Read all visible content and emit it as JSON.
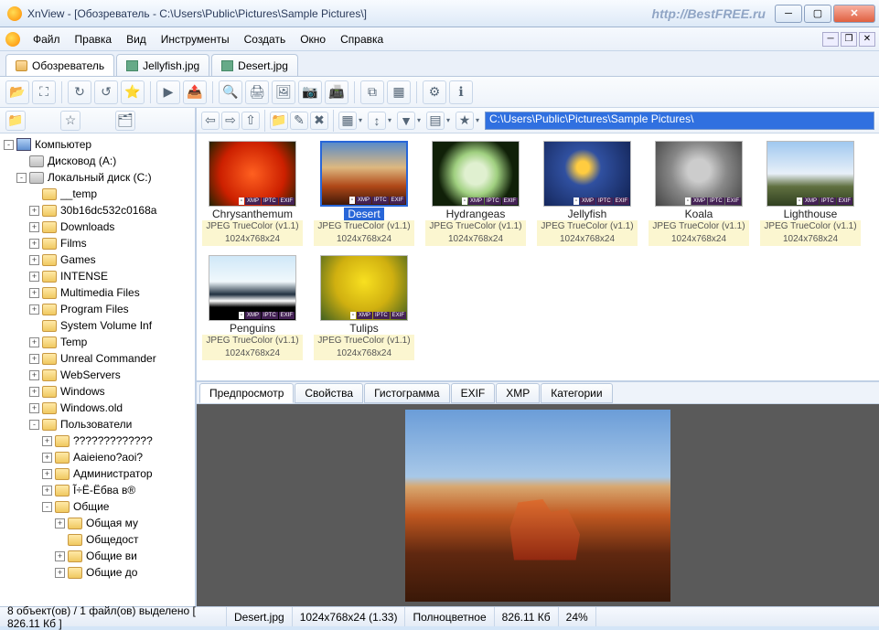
{
  "title": "XnView - [Обозреватель - C:\\Users\\Public\\Pictures\\Sample Pictures\\]",
  "watermark": "http://BestFREE.ru",
  "menu": [
    "Файл",
    "Правка",
    "Вид",
    "Инструменты",
    "Создать",
    "Окно",
    "Справка"
  ],
  "doc_tabs": [
    {
      "label": "Обозреватель",
      "icon": "br",
      "active": true
    },
    {
      "label": "Jellyfish.jpg",
      "icon": "img",
      "active": false
    },
    {
      "label": "Desert.jpg",
      "icon": "img",
      "active": false
    }
  ],
  "address": "C:\\Users\\Public\\Pictures\\Sample Pictures\\",
  "tree": [
    {
      "ind": 0,
      "exp": "-",
      "icon": "pc",
      "label": "Компьютер"
    },
    {
      "ind": 1,
      "exp": "",
      "icon": "drv",
      "label": "Дисковод (A:)"
    },
    {
      "ind": 1,
      "exp": "-",
      "icon": "drv",
      "label": "Локальный диск (C:)"
    },
    {
      "ind": 2,
      "exp": "",
      "icon": "fold",
      "label": "__temp"
    },
    {
      "ind": 2,
      "exp": "+",
      "icon": "fold",
      "label": "30b16dc532c0168a"
    },
    {
      "ind": 2,
      "exp": "+",
      "icon": "fold",
      "label": "Downloads"
    },
    {
      "ind": 2,
      "exp": "+",
      "icon": "fold",
      "label": "Films"
    },
    {
      "ind": 2,
      "exp": "+",
      "icon": "fold",
      "label": "Games"
    },
    {
      "ind": 2,
      "exp": "+",
      "icon": "fold",
      "label": "INTENSE"
    },
    {
      "ind": 2,
      "exp": "+",
      "icon": "fold",
      "label": "Multimedia Files"
    },
    {
      "ind": 2,
      "exp": "+",
      "icon": "fold",
      "label": "Program Files"
    },
    {
      "ind": 2,
      "exp": "",
      "icon": "fold",
      "label": "System Volume Inf"
    },
    {
      "ind": 2,
      "exp": "+",
      "icon": "fold",
      "label": "Temp"
    },
    {
      "ind": 2,
      "exp": "+",
      "icon": "fold",
      "label": "Unreal Commander"
    },
    {
      "ind": 2,
      "exp": "+",
      "icon": "fold",
      "label": "WebServers"
    },
    {
      "ind": 2,
      "exp": "+",
      "icon": "fold",
      "label": "Windows"
    },
    {
      "ind": 2,
      "exp": "+",
      "icon": "fold",
      "label": "Windows.old"
    },
    {
      "ind": 2,
      "exp": "-",
      "icon": "fold",
      "label": "Пользователи"
    },
    {
      "ind": 3,
      "exp": "+",
      "icon": "fold",
      "label": "?????????????"
    },
    {
      "ind": 3,
      "exp": "+",
      "icon": "fold",
      "label": "Aaieieno?aoi?"
    },
    {
      "ind": 3,
      "exp": "+",
      "icon": "fold",
      "label": "Администратор"
    },
    {
      "ind": 3,
      "exp": "+",
      "icon": "fold",
      "label": "Ĩ÷Ë-Ёбва в®"
    },
    {
      "ind": 3,
      "exp": "-",
      "icon": "fold",
      "label": "Общие"
    },
    {
      "ind": 4,
      "exp": "+",
      "icon": "fold",
      "label": "Общая му"
    },
    {
      "ind": 4,
      "exp": "",
      "icon": "fold",
      "label": "Общедост"
    },
    {
      "ind": 4,
      "exp": "+",
      "icon": "fold",
      "label": "Общие ви"
    },
    {
      "ind": 4,
      "exp": "+",
      "icon": "fold",
      "label": "Общие до"
    }
  ],
  "thumbs": [
    {
      "name": "Chrysanthemum",
      "info": "JPEG TrueColor (v1.1)",
      "dim": "1024x768x24",
      "art": "art-chrys"
    },
    {
      "name": "Desert",
      "info": "JPEG TrueColor (v1.1)",
      "dim": "1024x768x24",
      "art": "art-desert",
      "selected": true
    },
    {
      "name": "Hydrangeas",
      "info": "JPEG TrueColor (v1.1)",
      "dim": "1024x768x24",
      "art": "art-hydr"
    },
    {
      "name": "Jellyfish",
      "info": "JPEG TrueColor (v1.1)",
      "dim": "1024x768x24",
      "art": "art-jelly"
    },
    {
      "name": "Koala",
      "info": "JPEG TrueColor (v1.1)",
      "dim": "1024x768x24",
      "art": "art-koala"
    },
    {
      "name": "Lighthouse",
      "info": "JPEG TrueColor (v1.1)",
      "dim": "1024x768x24",
      "art": "art-light"
    },
    {
      "name": "Penguins",
      "info": "JPEG TrueColor (v1.1)",
      "dim": "1024x768x24",
      "art": "art-peng"
    },
    {
      "name": "Tulips",
      "info": "JPEG TrueColor (v1.1)",
      "dim": "1024x768x24",
      "art": "art-tulip"
    }
  ],
  "badges": [
    "XMP",
    "IPTC",
    "EXIF"
  ],
  "preview_tabs": [
    "Предпросмотр",
    "Свойства",
    "Гистограмма",
    "EXIF",
    "XMP",
    "Категории"
  ],
  "status": {
    "count": "8 объект(ов) / 1 файл(ов) выделено [ 826.11 Кб ]",
    "file": "Desert.jpg",
    "dims": "1024x768x24 (1.33)",
    "mode": "Полноцветное",
    "size": "826.11 Кб",
    "zoom": "24%"
  }
}
